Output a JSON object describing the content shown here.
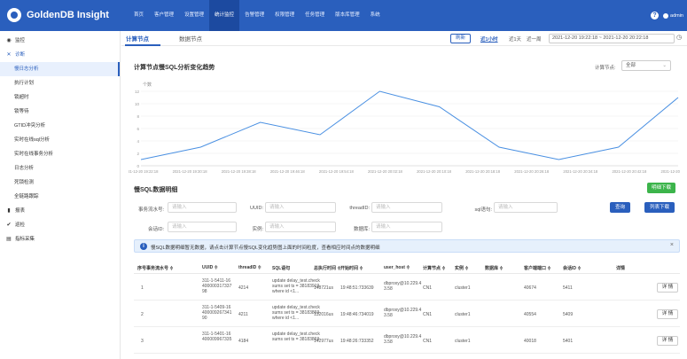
{
  "app": {
    "title": "GoldenDB Insight",
    "user": "admin"
  },
  "nav": [
    "首页",
    "客户管理",
    "设置管理",
    "统计监控",
    "告警管理",
    "权限管理",
    "任务管理",
    "版本库管理",
    "系统"
  ],
  "nav_active_index": 3,
  "sidebar": [
    {
      "label": "监控",
      "icon": "eye-icon",
      "type": "group"
    },
    {
      "label": "诊断",
      "icon": "wrench-icon",
      "type": "open"
    },
    {
      "label": "慢日志分析",
      "type": "sub",
      "active": true
    },
    {
      "label": "执行计划",
      "type": "sub"
    },
    {
      "label": "锁超时",
      "type": "sub"
    },
    {
      "label": "锁等待",
      "type": "sub"
    },
    {
      "label": "GTID冲突分析",
      "type": "sub"
    },
    {
      "label": "实时在线sql分析",
      "type": "sub"
    },
    {
      "label": "实时在线事务分析",
      "type": "sub"
    },
    {
      "label": "日志分析",
      "type": "sub"
    },
    {
      "label": "死锁检测",
      "type": "sub"
    },
    {
      "label": "全链路跟踪",
      "type": "sub"
    },
    {
      "label": "报表",
      "icon": "bar-chart-icon",
      "type": "group"
    },
    {
      "label": "巡检",
      "icon": "check-icon",
      "type": "group"
    },
    {
      "label": "指标采集",
      "icon": "database-icon",
      "type": "group"
    }
  ],
  "tabs": [
    "计算节点",
    "数据节点"
  ],
  "toolbar": {
    "refresh": "刷新",
    "ranges": [
      "近1小时",
      "近1天",
      "近一周"
    ],
    "date_range": "2021-12-20 19:22:18 ~ 2021-12-20 20:22:18"
  },
  "trend": {
    "title": "计算节点慢SQL分析变化趋势",
    "node_label": "计算节点:",
    "node_value": "全部"
  },
  "chart_data": {
    "type": "line",
    "ylabel": "个数",
    "ylim": [
      0,
      12
    ],
    "yticks": [
      0,
      2,
      4,
      6,
      8,
      10,
      12
    ],
    "x": [
      "2021-12-20 19:22:18",
      "2021-12-20 19:30:18",
      "2021-12-20 19:38:18",
      "2021-12-20 19:46:18",
      "2021-12-20 19:54:18",
      "2021-12-20 20:02:18",
      "2021-12-20 20:10:18",
      "2021-12-20 20:18:18",
      "2021-12-20 20:26:18",
      "2021-12-20 20:34:18",
      "2021-12-20 20:42:18",
      "2021-12-20 20:50:18"
    ],
    "series": [
      {
        "values": [
          1,
          3,
          7,
          5,
          12,
          9.5,
          3,
          1,
          3,
          11
        ]
      }
    ],
    "series_x_index": [
      0,
      1,
      2,
      3,
      4,
      5,
      6,
      7,
      8,
      9
    ],
    "colors": {
      "line": "#4a90e2",
      "grid": "#eeeeee"
    }
  },
  "detail": {
    "title": "慢SQL数据明细",
    "download": "明细下载",
    "fields": [
      {
        "label": "事务流水号:",
        "placeholder": "请输入"
      },
      {
        "label": "UUID:",
        "placeholder": "请输入"
      },
      {
        "label": "threadID:",
        "placeholder": "请输入"
      },
      {
        "label": "sql语句:",
        "placeholder": "请输入"
      },
      {
        "label": "会话ID:",
        "placeholder": "请输入"
      },
      {
        "label": "实例:",
        "placeholder": "请输入"
      },
      {
        "label": "数据库:",
        "placeholder": "请输入"
      }
    ],
    "query": "查询",
    "list_download": "列表下载",
    "alert": "慢SQL数据明细暂无数据，请点击计算节点慢SQL变化趋势图上面的时间粒度，查看相应时间点的数据明细"
  },
  "table": {
    "headers": [
      "序号",
      "事务流水号 ≑",
      "UUID ≑",
      "threadID ≑",
      "SQL语句",
      "总执行时间 ≑",
      "开始时间 ≑",
      "user_host ≑",
      "计算节点 ≑",
      "实例 ≑",
      "数据库 ≑",
      "客户端端口 ≑",
      "会话ID ≑",
      "详情"
    ],
    "rows": [
      {
        "no": "1",
        "uuid": [
          "311-1-5411-16",
          "400000317337",
          "98"
        ],
        "thread": "4214",
        "sql": [
          "update delay_test.check",
          "sums set ts = 38183919",
          "where id <1..."
        ],
        "time": "148721us",
        "start": "19:48:51:733639",
        "host": [
          "dbproxy@10.229.4",
          "3.58"
        ],
        "node": "CN1",
        "instance": "cluster1",
        "port": "40674",
        "session": "5411",
        "action": "详 情"
      },
      {
        "no": "2",
        "uuid": [
          "311-1-5409-16",
          "400009267341",
          "90"
        ],
        "thread": "4211",
        "sql": [
          "update delay_test.check",
          "sums set ts = 38183869",
          "where id <1..."
        ],
        "time": "132016us",
        "start": "19:48:46:734019",
        "host": [
          "dbproxy@10.229.4",
          "3.58"
        ],
        "node": "CN1",
        "instance": "cluster1",
        "port": "40554",
        "session": "5409",
        "action": "详 情"
      },
      {
        "no": "3",
        "uuid": [
          "311-1-5401-16",
          "400009967335"
        ],
        "thread": "4184",
        "sql": [
          "update delay_test.check",
          "sums set ts = 38183869"
        ],
        "time": "142977us",
        "start": "19:48:26:733352",
        "host": [
          "dbproxy@10.229.4",
          "3.58"
        ],
        "node": "CN1",
        "instance": "cluster1",
        "port": "40018",
        "session": "5401",
        "action": "详 情"
      }
    ]
  }
}
